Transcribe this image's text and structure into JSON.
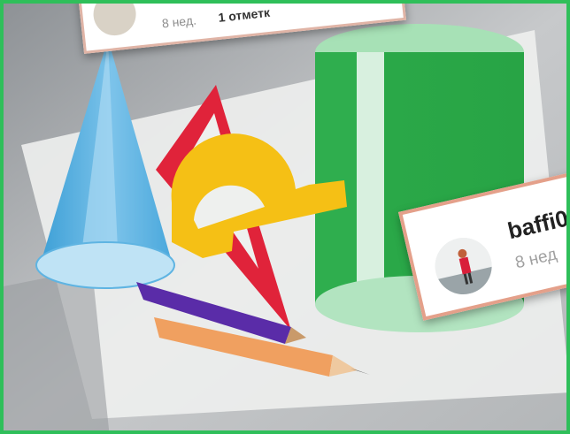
{
  "colors": {
    "frame": "#2fbf5a",
    "cone": "#4eaee0",
    "cylinder": "#2fae4e",
    "triangle_ruler": "#e0233a",
    "protractor": "#f5c015",
    "purple_pencil": "#5a2ca8",
    "orange_pencil": "#f0a060"
  },
  "post_top": {
    "time": "8 нед.",
    "likes": "1 отметк"
  },
  "post_right": {
    "username": "baffi0",
    "time": "8 нед"
  }
}
